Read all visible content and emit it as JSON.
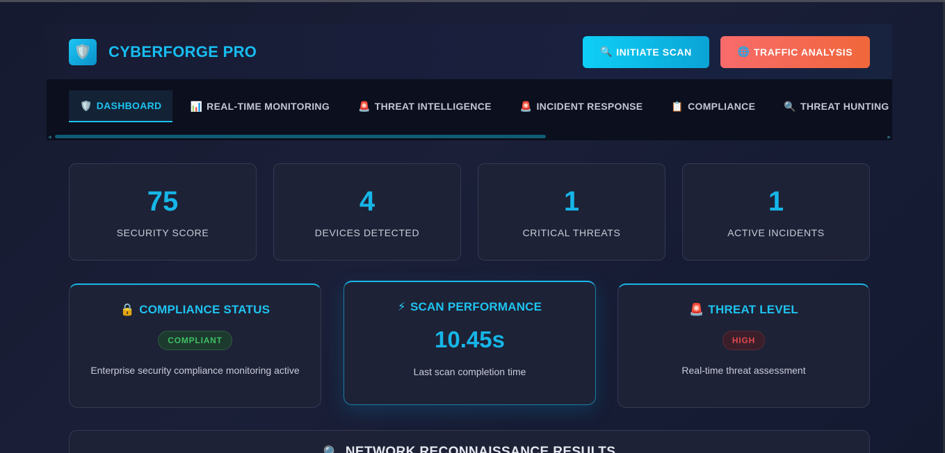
{
  "app": {
    "title": "CYBERFORGE PRO",
    "logo_icon": "🛡️"
  },
  "header": {
    "scan_button": {
      "icon": "🔍",
      "label": "INITIATE SCAN"
    },
    "traffic_button": {
      "icon": "🌐",
      "label": "TRAFFIC ANALYSIS"
    }
  },
  "nav": {
    "tabs": [
      {
        "icon": "🛡️",
        "label": "DASHBOARD",
        "active": true
      },
      {
        "icon": "📊",
        "label": "REAL-TIME MONITORING"
      },
      {
        "icon": "🚨",
        "label": "THREAT INTELLIGENCE"
      },
      {
        "icon": "🚨",
        "label": "INCIDENT RESPONSE"
      },
      {
        "icon": "📋",
        "label": "COMPLIANCE"
      },
      {
        "icon": "🔍",
        "label": "THREAT HUNTING"
      }
    ]
  },
  "stats": [
    {
      "value": "75",
      "label": "SECURITY SCORE"
    },
    {
      "value": "4",
      "label": "DEVICES DETECTED"
    },
    {
      "value": "1",
      "label": "CRITICAL THREATS"
    },
    {
      "value": "1",
      "label": "ACTIVE INCIDENTS"
    }
  ],
  "panels": {
    "compliance": {
      "icon": "🔒",
      "title": "COMPLIANCE STATUS",
      "badge": "COMPLIANT",
      "description": "Enterprise security compliance monitoring active"
    },
    "scan": {
      "icon": "⚡",
      "title": "SCAN PERFORMANCE",
      "metric": "10.45s",
      "description": "Last scan completion time"
    },
    "threat": {
      "icon": "🚨",
      "title": "THREAT LEVEL",
      "badge": "HIGH",
      "description": "Real-time threat assessment"
    }
  },
  "recon": {
    "icon": "🔍",
    "title": "NETWORK RECONNAISSANCE RESULTS"
  },
  "colors": {
    "accent": "#17bdf0",
    "scan_btn": "#0fcff6",
    "traffic_btn": "#f86b6b",
    "ok": "#3fbf64",
    "danger": "#e2484e"
  }
}
